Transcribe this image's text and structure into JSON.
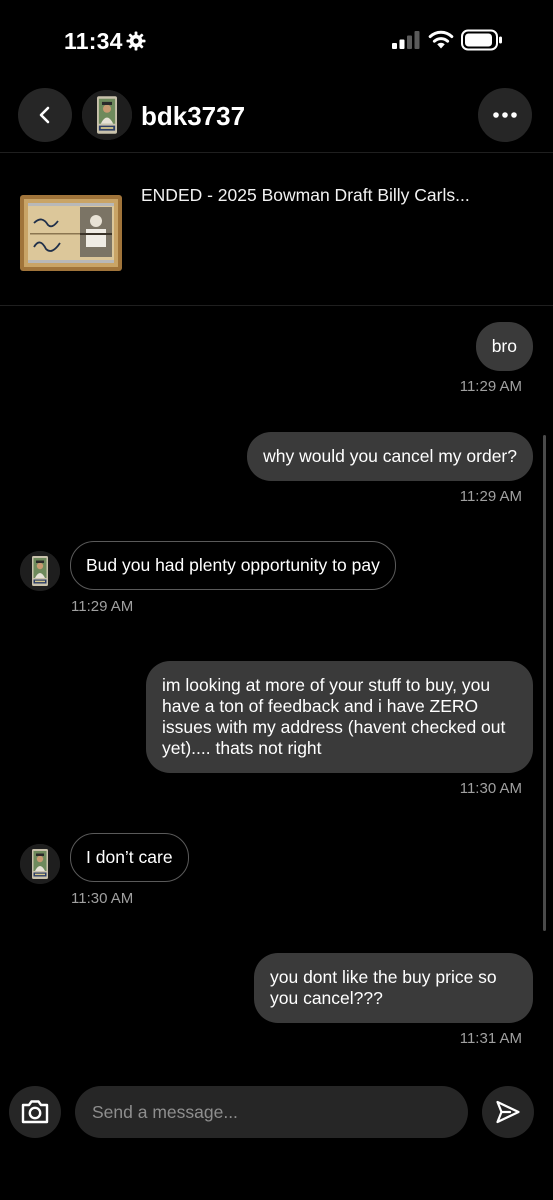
{
  "status_bar": {
    "time": "11:34",
    "icons": [
      "gear-icon",
      "signal-icon",
      "wifi-icon",
      "battery-icon"
    ]
  },
  "header": {
    "username": "bdk3737",
    "icons": [
      "chevron-left-icon",
      "more-icon"
    ]
  },
  "listing": {
    "title": "ENDED - 2025 Bowman Draft Billy Carls..."
  },
  "messages": [
    {
      "direction": "outgoing",
      "text": "bro",
      "time": "11:29 AM"
    },
    {
      "direction": "outgoing",
      "text": "why would you cancel my order?",
      "time": "11:29 AM"
    },
    {
      "direction": "incoming",
      "text": "Bud you had plenty opportunity to pay",
      "time": "11:29 AM"
    },
    {
      "direction": "outgoing",
      "text": "im looking at more of your stuff to buy, you have a ton of feedback and i have ZERO issues with my address (havent checked out yet).... thats not right",
      "time": "11:30 AM"
    },
    {
      "direction": "incoming",
      "text": "I don’t care",
      "time": "11:30 AM"
    },
    {
      "direction": "outgoing",
      "text": "you dont like the buy price so you cancel???",
      "time": "11:31 AM"
    }
  ],
  "composer": {
    "placeholder": "Send a message...",
    "icons": [
      "camera-icon",
      "send-icon"
    ]
  },
  "colors": {
    "background": "#000000",
    "outgoing_bubble": "#3a3a3a",
    "incoming_border": "#5a5a5a",
    "timestamp": "#a0a0a0",
    "button_bg": "#262626"
  }
}
